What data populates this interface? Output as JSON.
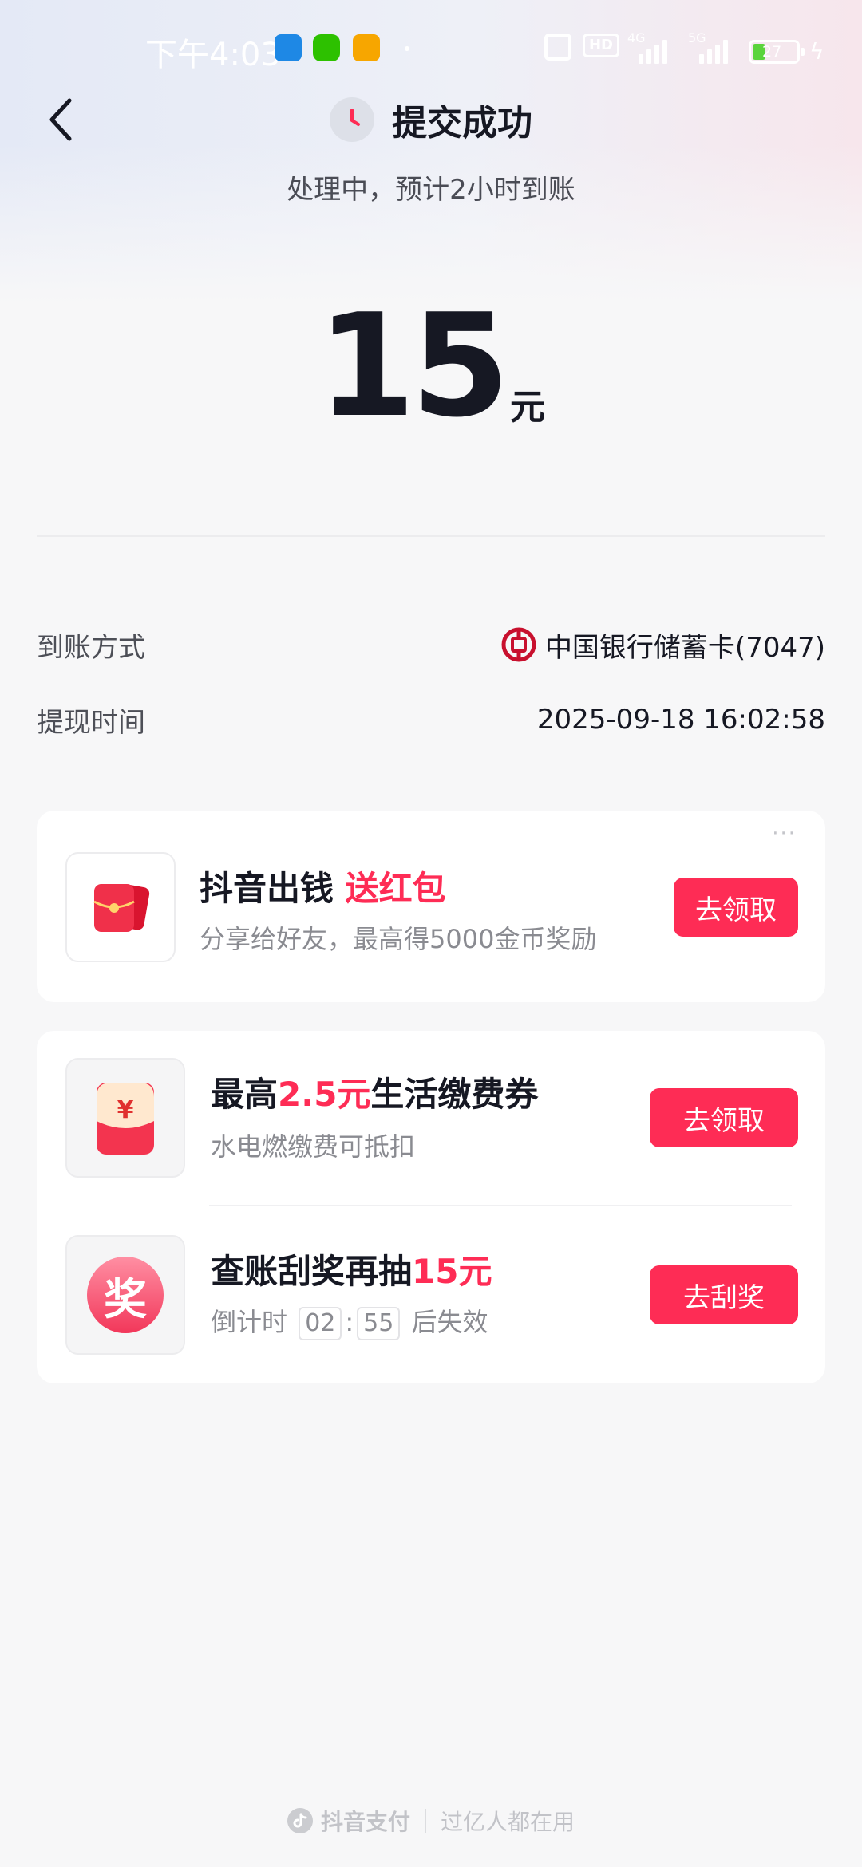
{
  "status_bar": {
    "time": "下午4:03",
    "hd_label": "HD",
    "net_4g": "4G",
    "net_5g": "5G",
    "battery": "27"
  },
  "header": {
    "title": "提交成功",
    "subtitle": "处理中，预计2小时到账"
  },
  "amount": {
    "value": "15",
    "unit": "元"
  },
  "details": [
    {
      "label": "到账方式",
      "value": "中国银行储蓄卡(7047)"
    },
    {
      "label": "提现时间",
      "value": "2025-09-18 16:02:58"
    }
  ],
  "promo1": {
    "more": "···",
    "title_main": "抖音出钱",
    "title_highlight": "送红包",
    "desc": "分享给好友，最高得5000金币奖励",
    "button": "去领取"
  },
  "promo2": {
    "title_pre": "最高",
    "title_highlight": "2.5元",
    "title_post": "生活缴费券",
    "desc": "水电燃缴费可抵扣",
    "button": "去领取",
    "icon_symbol": "¥"
  },
  "promo3": {
    "title_pre": "查账刮奖再抽",
    "title_highlight": "15元",
    "desc_pre": "倒计时",
    "timer_min": "02",
    "timer_sep": ":",
    "timer_sec": "55",
    "desc_post": "后失效",
    "button": "去刮奖",
    "icon_text": "奖"
  },
  "footer": {
    "brand": "抖音支付",
    "slogan": "过亿人都在用"
  },
  "colors": {
    "accent": "#fe2c55",
    "text_primary": "#161823",
    "text_secondary": "#8a8b91",
    "background": "#f7f7f8"
  }
}
